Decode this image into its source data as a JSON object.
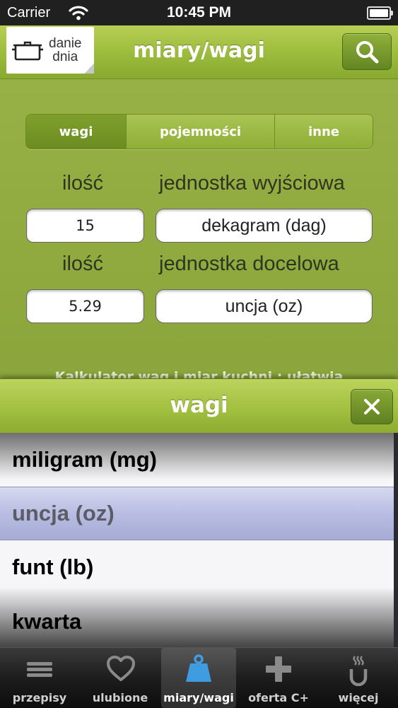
{
  "status_bar": {
    "carrier": "Carrier",
    "time": "10:45 PM"
  },
  "nav": {
    "logo_line1": "danie",
    "logo_line2": "dnia",
    "title": "miary/wagi",
    "search_icon": "search-icon"
  },
  "segments": [
    {
      "label": "wagi",
      "active": true
    },
    {
      "label": "pojemności",
      "active": false
    },
    {
      "label": "inne",
      "active": false
    }
  ],
  "converter": {
    "source": {
      "qty_label": "ilość",
      "unit_label": "jednostka wyjściowa",
      "qty": "15",
      "unit": "dekagram (dag)"
    },
    "target": {
      "qty_label": "ilość",
      "unit_label": "jednostka docelowa",
      "qty": "5.29",
      "unit": "uncja (oz)"
    },
    "description": "Kalkulator wag i miar kuchni : ułatwia"
  },
  "sheet": {
    "title": "wagi",
    "close_icon": "close-icon",
    "options": [
      "miligram (mg)",
      "uncja (oz)",
      "funt (lb)",
      "kwarta"
    ],
    "selected_index": 1
  },
  "tabs": [
    {
      "label": "przepisy",
      "icon": "menu-list-icon"
    },
    {
      "label": "ulubione",
      "icon": "heart-icon"
    },
    {
      "label": "miary/wagi",
      "icon": "scale-weight-icon",
      "active": true
    },
    {
      "label": "oferta C+",
      "icon": "plus-icon"
    },
    {
      "label": "więcej",
      "icon": "steaming-cup-icon"
    }
  ],
  "colors": {
    "accent_green": "#9bbb3c",
    "dark_green": "#6c8c20",
    "picker_selected": "#b9bde2",
    "tab_active_icon": "#3f9ce0"
  }
}
